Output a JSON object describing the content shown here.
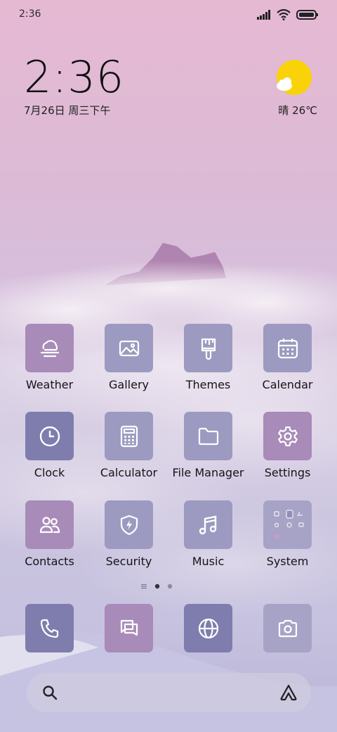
{
  "status": {
    "time": "2:36"
  },
  "clock_widget": {
    "time": "2:36",
    "date": "7月26日 周三下午"
  },
  "weather_widget": {
    "condition": "晴",
    "temperature": "26℃"
  },
  "apps": [
    {
      "label": "Weather",
      "icon": "weather-icon"
    },
    {
      "label": "Gallery",
      "icon": "gallery-icon"
    },
    {
      "label": "Themes",
      "icon": "themes-brush-icon"
    },
    {
      "label": "Calendar",
      "icon": "calendar-icon"
    },
    {
      "label": "Clock",
      "icon": "clock-icon"
    },
    {
      "label": "Calculator",
      "icon": "calculator-icon"
    },
    {
      "label": "File Manager",
      "icon": "folder-icon"
    },
    {
      "label": "Settings",
      "icon": "gear-icon"
    },
    {
      "label": "Contacts",
      "icon": "contacts-icon"
    },
    {
      "label": "Security",
      "icon": "shield-icon"
    },
    {
      "label": "Music",
      "icon": "music-note-icon"
    },
    {
      "label": "System",
      "icon": "system-folder-icon"
    }
  ],
  "page_indicator": {
    "current_page": 2
  },
  "dock": [
    {
      "icon": "phone-icon"
    },
    {
      "icon": "messages-icon"
    },
    {
      "icon": "browser-globe-icon"
    },
    {
      "icon": "camera-icon"
    }
  ],
  "search": {
    "icons": [
      "search-icon",
      "app-vault-icon"
    ]
  },
  "colors": {
    "tile_pink": "#a88bb8",
    "tile_lavender": "#9c9ac0",
    "tile_navy": "#7e7dae",
    "sun": "#f9d20a"
  }
}
